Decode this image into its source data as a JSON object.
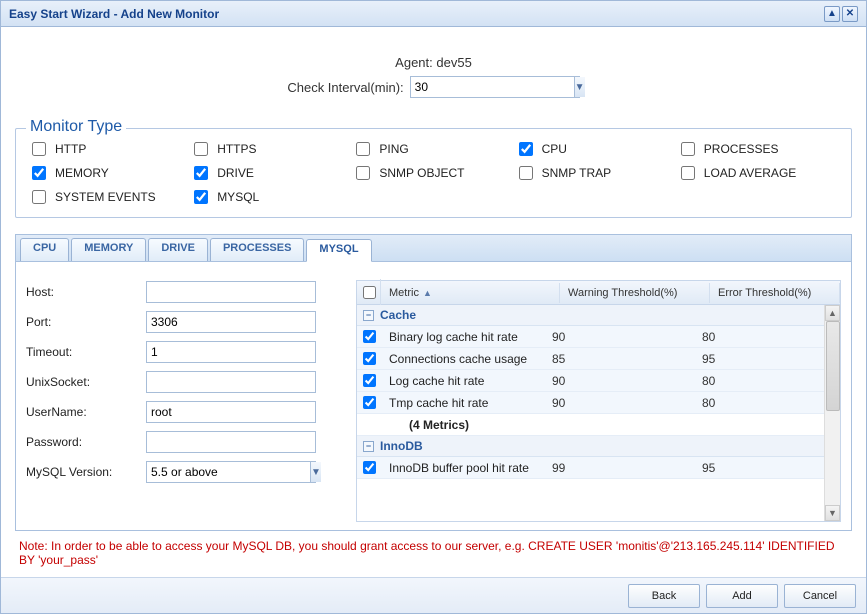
{
  "window": {
    "title": "Easy Start Wizard - Add New Monitor"
  },
  "agent": {
    "label": "Agent:",
    "value": "dev55"
  },
  "interval": {
    "label": "Check Interval(min):",
    "value": "30"
  },
  "monitor_type": {
    "legend": "Monitor Type",
    "items": [
      {
        "label": "HTTP",
        "checked": false
      },
      {
        "label": "HTTPS",
        "checked": false
      },
      {
        "label": "PING",
        "checked": false
      },
      {
        "label": "CPU",
        "checked": true
      },
      {
        "label": "PROCESSES",
        "checked": false
      },
      {
        "label": "MEMORY",
        "checked": true
      },
      {
        "label": "DRIVE",
        "checked": true
      },
      {
        "label": "SNMP OBJECT",
        "checked": false
      },
      {
        "label": "SNMP TRAP",
        "checked": false
      },
      {
        "label": "LOAD AVERAGE",
        "checked": false
      },
      {
        "label": "SYSTEM EVENTS",
        "checked": false
      },
      {
        "label": "MYSQL",
        "checked": true
      }
    ]
  },
  "tabs": [
    {
      "label": "CPU",
      "active": false
    },
    {
      "label": "MEMORY",
      "active": false
    },
    {
      "label": "DRIVE",
      "active": false
    },
    {
      "label": "PROCESSES",
      "active": false
    },
    {
      "label": "MYSQL",
      "active": true
    }
  ],
  "form": {
    "host": {
      "label": "Host:",
      "value": ""
    },
    "port": {
      "label": "Port:",
      "value": "3306"
    },
    "timeout": {
      "label": "Timeout:",
      "value": "1"
    },
    "unixsocket": {
      "label": "UnixSocket:",
      "value": ""
    },
    "username": {
      "label": "UserName:",
      "value": "root"
    },
    "password": {
      "label": "Password:",
      "value": ""
    },
    "version": {
      "label": "MySQL Version:",
      "value": "5.5 or above"
    }
  },
  "grid": {
    "columns": {
      "metric": "Metric",
      "warning": "Warning Threshold(%)",
      "error": "Error Threshold(%)"
    },
    "groups": [
      {
        "name": "Cache",
        "rows": [
          {
            "metric": "Binary log cache hit rate",
            "warn": "90",
            "err": "80",
            "checked": true
          },
          {
            "metric": "Connections cache usage",
            "warn": "85",
            "err": "95",
            "checked": true
          },
          {
            "metric": "Log cache hit rate",
            "warn": "90",
            "err": "80",
            "checked": true
          },
          {
            "metric": "Tmp cache hit rate",
            "warn": "90",
            "err": "80",
            "checked": true
          }
        ],
        "summary": "(4 Metrics)"
      },
      {
        "name": "InnoDB",
        "rows": [
          {
            "metric": "InnoDB buffer pool hit rate",
            "warn": "99",
            "err": "95",
            "checked": true
          }
        ]
      }
    ]
  },
  "note": "Note: In order to be able to access your MySQL DB, you should grant access to our server, e.g. CREATE USER 'monitis'@'213.165.245.114' IDENTIFIED BY 'your_pass'",
  "buttons": {
    "back": "Back",
    "add": "Add",
    "cancel": "Cancel"
  }
}
